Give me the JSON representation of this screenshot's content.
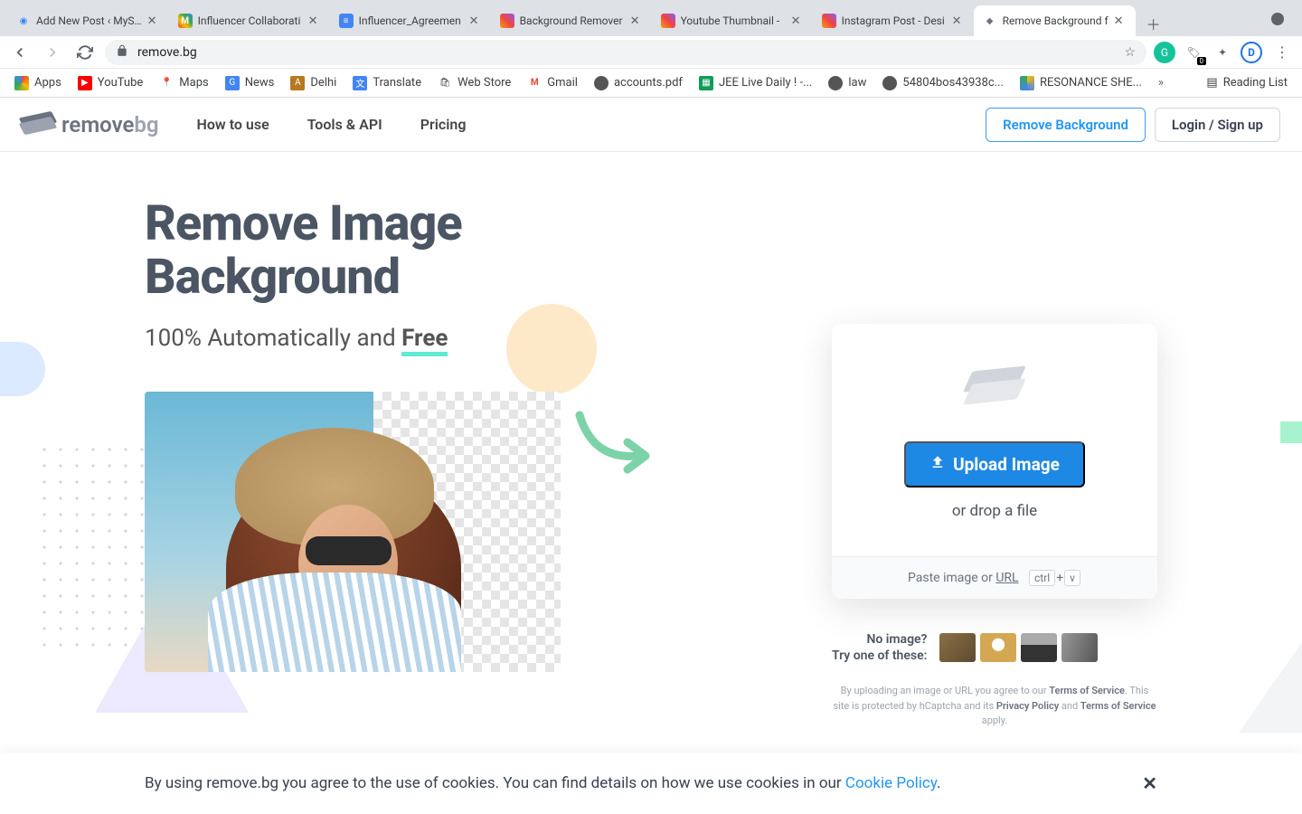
{
  "browser": {
    "tabs": [
      {
        "title": "Add New Post ‹ MyS…",
        "fav_bg": "#fff",
        "fav_txt": "🔵"
      },
      {
        "title": "Influencer Collaborati",
        "fav_bg": "#fff",
        "fav_txt": "M"
      },
      {
        "title": "Influencer_Agreemen",
        "fav_bg": "#4285f4",
        "fav_txt": "≡"
      },
      {
        "title": "Background Remover",
        "fav_bg": "#fff",
        "fav_txt": "🟧"
      },
      {
        "title": "Youtube Thumbnail -",
        "fav_bg": "#fff",
        "fav_txt": "🟧"
      },
      {
        "title": "Instagram Post - Desi",
        "fav_bg": "#fff",
        "fav_txt": "🟧"
      },
      {
        "title": "Remove Background f",
        "fav_bg": "#fff",
        "fav_txt": "◆",
        "active": true
      }
    ],
    "url": "remove.bg",
    "ext_badge": "0",
    "bookmarks": [
      {
        "label": "Apps",
        "ico": "⋮⋮⋮",
        "bg": ""
      },
      {
        "label": "YouTube",
        "ico": "▶",
        "bg": "#ff0000"
      },
      {
        "label": "Maps",
        "ico": "📍",
        "bg": ""
      },
      {
        "label": "News",
        "ico": "G",
        "bg": "#4285f4"
      },
      {
        "label": "Delhi",
        "ico": "A",
        "bg": "#b7791f"
      },
      {
        "label": "Translate",
        "ico": "文",
        "bg": "#4285f4"
      },
      {
        "label": "Web Store",
        "ico": "🛍",
        "bg": ""
      },
      {
        "label": "Gmail",
        "ico": "M",
        "bg": ""
      },
      {
        "label": "accounts.pdf",
        "ico": "●",
        "bg": "#555"
      },
      {
        "label": "JEE Live Daily ! -...",
        "ico": "▦",
        "bg": "#0f9d58"
      },
      {
        "label": "law",
        "ico": "●",
        "bg": "#555"
      },
      {
        "label": "54804bos43938c...",
        "ico": "●",
        "bg": "#555"
      },
      {
        "label": "RESONANCE SHE...",
        "ico": "△",
        "bg": ""
      }
    ],
    "reading_list": "Reading List"
  },
  "site": {
    "logo_a": "remove",
    "logo_b": "bg",
    "nav": [
      "How to use",
      "Tools & API",
      "Pricing"
    ],
    "btn_primary": "Remove Background",
    "btn_secondary": "Login / Sign up"
  },
  "hero": {
    "h1a": "Remove Image",
    "h1b": "Background",
    "sub_a": "100% Automatically and ",
    "sub_free": "Free"
  },
  "upload": {
    "btn": "Upload Image",
    "drop": "or drop a file",
    "paste": "Paste image or ",
    "url": "URL",
    "k1": "ctrl",
    "kplus": "+",
    "k2": "v"
  },
  "samples": {
    "l1": "No image?",
    "l2": "Try one of these:"
  },
  "legal": {
    "a": "By uploading an image or URL you agree to our ",
    "tos": "Terms of Service",
    "b": ". This site is protected by hCaptcha and its ",
    "pp": "Privacy Policy",
    "c": " and ",
    "tos2": "Terms of Service",
    "d": " apply."
  },
  "cookie": {
    "a": "By using remove.bg you agree to the use of cookies. You can find details on how we use cookies in our ",
    "link": "Cookie Policy",
    "b": "."
  }
}
